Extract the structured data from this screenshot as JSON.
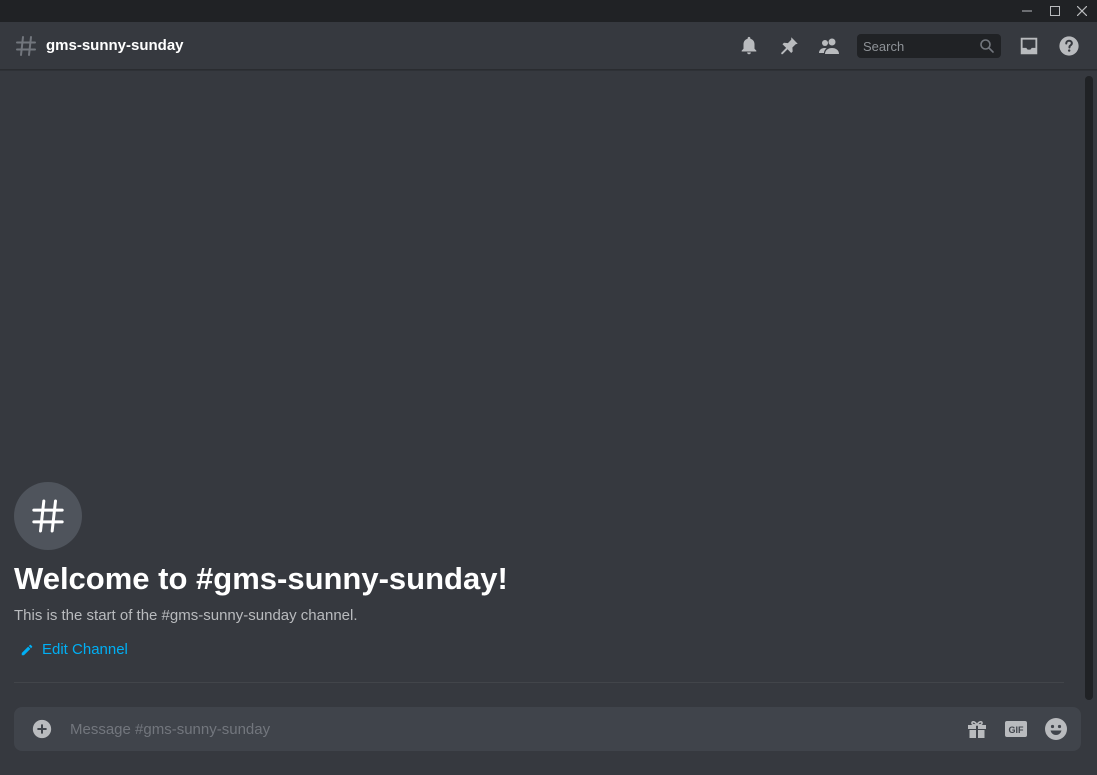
{
  "window": {
    "controls": [
      "minimize",
      "maximize",
      "close"
    ]
  },
  "header": {
    "channel_icon": "hashtag-icon",
    "channel_name": "gms-sunny-sunday",
    "icons": [
      "bell-icon",
      "pin-icon",
      "members-icon",
      "inbox-icon",
      "help-icon"
    ],
    "search": {
      "placeholder": "Search",
      "value": ""
    }
  },
  "welcome": {
    "icon": "hashtag-icon",
    "title": "Welcome to #gms-sunny-sunday!",
    "subtitle": "This is the start of the #gms-sunny-sunday channel.",
    "edit_label": "Edit Channel"
  },
  "composer": {
    "placeholder": "Message #gms-sunny-sunday",
    "value": "",
    "icons": [
      "add-attachment-icon",
      "gift-icon",
      "gif-icon",
      "emoji-icon"
    ]
  },
  "colors": {
    "background": "#36393f",
    "titlebar": "#202225",
    "accent_link": "#00aff4",
    "composer_bg": "#40444b",
    "icon_gray": "#b9bbbe"
  }
}
